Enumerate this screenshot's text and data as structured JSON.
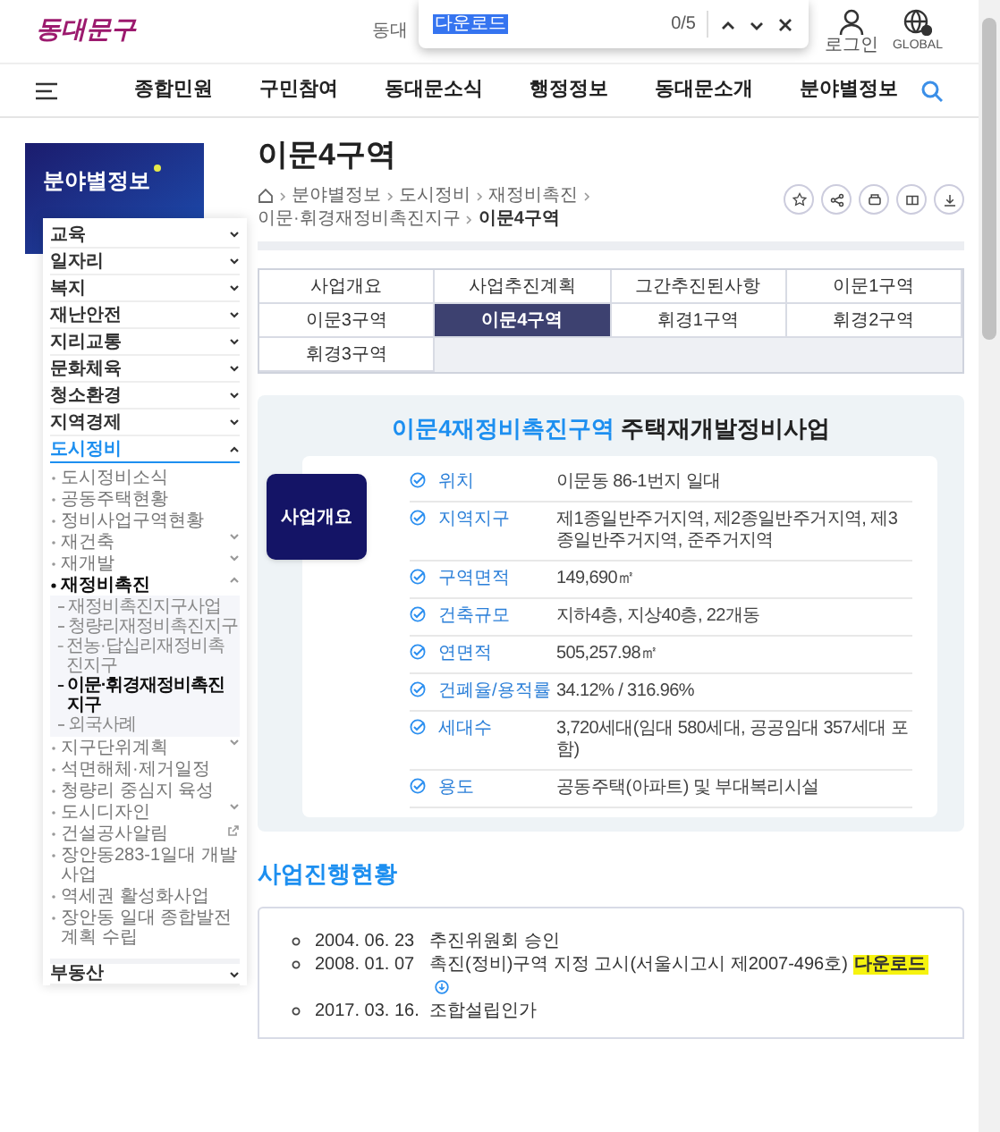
{
  "header": {
    "logo": "동대문구",
    "hint": "동대",
    "login": "로그인",
    "global": "GLOBAL"
  },
  "find_bar": {
    "value": "다운로드",
    "count": "0/5"
  },
  "nav": {
    "items": [
      "종합민원",
      "구민참여",
      "동대문소식",
      "행정정보",
      "동대문소개",
      "분야별정보"
    ]
  },
  "sidebar": {
    "title": "분야별정보",
    "items": [
      {
        "label": "교육",
        "selected": false,
        "expanded": false
      },
      {
        "label": "일자리",
        "selected": false,
        "expanded": false
      },
      {
        "label": "복지",
        "selected": false,
        "expanded": false
      },
      {
        "label": "재난안전",
        "selected": false,
        "expanded": false
      },
      {
        "label": "지리교통",
        "selected": false,
        "expanded": false
      },
      {
        "label": "문화체육",
        "selected": false,
        "expanded": false
      },
      {
        "label": "청소환경",
        "selected": false,
        "expanded": false
      },
      {
        "label": "지역경제",
        "selected": false,
        "expanded": false
      },
      {
        "label": "도시정비",
        "selected": true,
        "expanded": true,
        "children": [
          {
            "label": "도시정비소식",
            "selected": false
          },
          {
            "label": "공동주택현황",
            "selected": false
          },
          {
            "label": "정비사업구역현황",
            "selected": false
          },
          {
            "label": "재건축",
            "selected": false,
            "expanded": false
          },
          {
            "label": "재개발",
            "selected": false,
            "expanded": false
          },
          {
            "label": "재정비촉진",
            "selected": true,
            "expanded": true,
            "children": [
              {
                "label": "재정비촉진지구사업",
                "selected": false
              },
              {
                "label": "청량리재정비촉진지구",
                "selected": false
              },
              {
                "label": "전농·답십리재정비촉진지구",
                "selected": false
              },
              {
                "label": "이문·휘경재정비촉진지구",
                "selected": true
              },
              {
                "label": "외국사례",
                "selected": false
              }
            ]
          },
          {
            "label": "지구단위계획",
            "selected": false,
            "expanded": false
          },
          {
            "label": "석면해체·제거일정",
            "selected": false
          },
          {
            "label": "청량리 중심지 육성",
            "selected": false
          },
          {
            "label": "도시디자인",
            "selected": false,
            "expanded": false
          },
          {
            "label": "건설공사알림",
            "selected": false,
            "external": true
          },
          {
            "label": "장안동283-1일대 개발사업",
            "selected": false
          },
          {
            "label": "역세권 활성화사업",
            "selected": false
          },
          {
            "label": "장안동 일대 종합발전계획 수립",
            "selected": false
          }
        ]
      },
      {
        "label": "부동산",
        "selected": false,
        "expanded": false
      }
    ]
  },
  "page": {
    "title": "이문4구역",
    "breadcrumb": [
      "분야별정보",
      "도시정비",
      "재정비촉진",
      "이문·휘경재정비촉진지구",
      "이문4구역"
    ]
  },
  "tabs": [
    {
      "label": "사업개요",
      "selected": false
    },
    {
      "label": "사업추진계획",
      "selected": false
    },
    {
      "label": "그간추진된사항",
      "selected": false
    },
    {
      "label": "이문1구역",
      "selected": false
    },
    {
      "label": "이문3구역",
      "selected": false
    },
    {
      "label": "이문4구역",
      "selected": true
    },
    {
      "label": "휘경1구역",
      "selected": false
    },
    {
      "label": "휘경2구역",
      "selected": false
    },
    {
      "label": "휘경3구역",
      "selected": false
    }
  ],
  "overview": {
    "headline_highlight": "이문4재정비촉진구역",
    "headline": "주택재개발정비사업",
    "badge": "사업개요",
    "rows": [
      {
        "label": "위치",
        "value": "이문동 86-1번지 일대"
      },
      {
        "label": "지역지구",
        "value": "제1종일반주거지역, 제2종일반주거지역, 제3종일반주거지역, 준주거지역"
      },
      {
        "label": "구역면적",
        "value": "149,690㎡"
      },
      {
        "label": "건축규모",
        "value": "지하4층, 지상40층, 22개동"
      },
      {
        "label": "연면적",
        "value": "505,257.98㎡"
      },
      {
        "label": "건폐율/용적률",
        "value": "34.12% / 316.96%"
      },
      {
        "label": "세대수",
        "value": "3,720세대(임대 580세대, 공공임대 357세대 포함)"
      },
      {
        "label": "용도",
        "value": "공동주택(아파트) 및 부대복리시설"
      }
    ]
  },
  "progress": {
    "title": "사업진행현황",
    "items": [
      {
        "date": "2004. 06. 23",
        "text": "추진위원회 승인"
      },
      {
        "date": "2008. 01. 07",
        "text": "촉진(정비)구역 지정 고시(서울시고시 제2007-496호)",
        "download": "다운로드"
      },
      {
        "date": "2017. 03. 16.",
        "text": "조합설립인가"
      }
    ]
  }
}
